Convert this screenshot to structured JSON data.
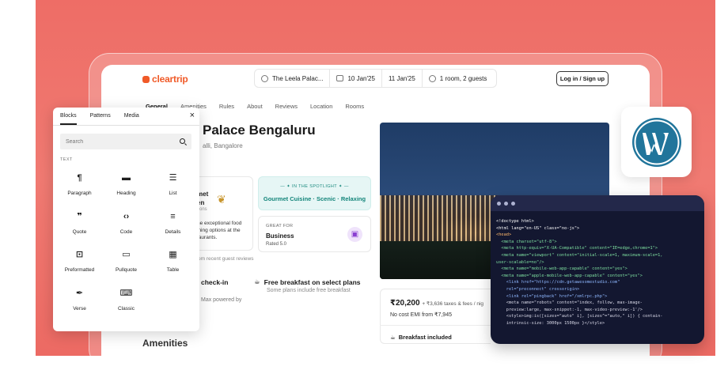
{
  "brand": {
    "logo_text": "cleartrip",
    "accent": "#f05a28",
    "bg": "#ee6d66"
  },
  "header": {
    "hotel": "The Leela Palac...",
    "checkin": "10 Jan'25",
    "checkout": "11 Jan'25",
    "guests": "1 room, 2 guests",
    "login": "Log in / Sign up"
  },
  "hotel_tabs": [
    "General",
    "Amenities",
    "Rules",
    "About",
    "Reviews",
    "Location",
    "Rooms"
  ],
  "hotel": {
    "name": "Palace Bengaluru",
    "location": "alli, Bangalore"
  },
  "gourmet": {
    "line1": "met",
    "line2": "en",
    "line3": "tions",
    "desc1": "he exceptional food",
    "desc2": "ining options at the",
    "desc3": "taurants.",
    "review_note": "om recent guest reviews"
  },
  "spotlight": {
    "kicker": "— ✦ IN THE SPOTLIGHT ✦ —",
    "value": "Gourmet Cuisine · Scenic · Relaxing"
  },
  "business": {
    "kicker": "GREAT FOR",
    "title": "Business",
    "rating": "Rated 5.0"
  },
  "checkin": {
    "title": "check-in",
    "sub": "Max powered by"
  },
  "breakfast": {
    "title": "Free breakfast on select plans",
    "sub": "Some plans include free breakfast"
  },
  "amenities_title": "Amenities",
  "price": {
    "amount": "₹20,200",
    "taxes": "+ ₹3,636 taxes & fees / nig",
    "emi": "No cost EMI from ₹7,945",
    "included": "Breakfast included"
  },
  "inserter": {
    "tabs": [
      "Blocks",
      "Patterns",
      "Media"
    ],
    "close": "×",
    "search_placeholder": "Search",
    "category": "TEXT",
    "blocks": [
      {
        "label": "Paragraph",
        "glyph": "¶",
        "icon": "paragraph-icon"
      },
      {
        "label": "Heading",
        "glyph": "▬",
        "icon": "heading-icon"
      },
      {
        "label": "List",
        "glyph": "☰",
        "icon": "list-icon"
      },
      {
        "label": "Quote",
        "glyph": "❞",
        "icon": "quote-icon"
      },
      {
        "label": "Code",
        "glyph": "‹›",
        "icon": "code-icon"
      },
      {
        "label": "Details",
        "glyph": "≡",
        "icon": "details-icon"
      },
      {
        "label": "Preformatted",
        "glyph": "⊡",
        "icon": "preformatted-icon"
      },
      {
        "label": "Pullquote",
        "glyph": "▭",
        "icon": "pullquote-icon"
      },
      {
        "label": "Table",
        "glyph": "▦",
        "icon": "table-icon"
      },
      {
        "label": "Verse",
        "glyph": "✒",
        "icon": "verse-icon"
      },
      {
        "label": "Classic",
        "glyph": "⌨",
        "icon": "classic-icon"
      }
    ]
  },
  "code_lines": [
    {
      "text": "<!doctype html>",
      "color": "#ffffff"
    },
    {
      "text": "<html lang=\"en-US\" class=\"no-js\">",
      "color": "#ffffff"
    },
    {
      "text": "<head>",
      "color": "#ffb86b"
    },
    {
      "text": "  <meta charset=\"utf-8\">",
      "color": "#7ee0a0"
    },
    {
      "text": "  <meta http-equiv=\"X-UA-Compatible\" content=\"IE=edge,chrome=1\">",
      "color": "#7ee0a0"
    },
    {
      "text": "  <meta name=\"viewport\" content=\"initial-scale=1, maximum-scale=1,",
      "color": "#7ee0a0"
    },
    {
      "text": "user-scalable=no\"/>",
      "color": "#7ee0a0"
    },
    {
      "text": "  <meta name=\"mobile-web-app-capable\" content=\"yes\">",
      "color": "#7ee0a0"
    },
    {
      "text": "  <meta name=\"apple-mobile-web-app-capable\" content=\"yes\">",
      "color": "#7ee0a0"
    },
    {
      "text": "    <link href=\"https://cdn.getawesomestudio.com\"",
      "color": "#8fb8ff"
    },
    {
      "text": "    rel=\"preconnect\" crossorigin>",
      "color": "#8fb8ff"
    },
    {
      "text": "    <link rel=\"pingback\" href=\"/xmlrpc.php\">",
      "color": "#8fb8ff"
    },
    {
      "text": "    <meta name=\"robots\" content=\"index, follow, max-image-",
      "color": "#d9d9e8"
    },
    {
      "text": "    preview:large, max-snippet:-1, max-video-preview:-1'/>",
      "color": "#d9d9e8"
    },
    {
      "text": "    <style>img:is([sizes=\"auto\" i], [sizes^=\"auto,\" i]) { contain-",
      "color": "#d9d9e8"
    },
    {
      "text": "    intrinsic-size: 3000px 1500px }</style>",
      "color": "#d9d9e8"
    }
  ]
}
